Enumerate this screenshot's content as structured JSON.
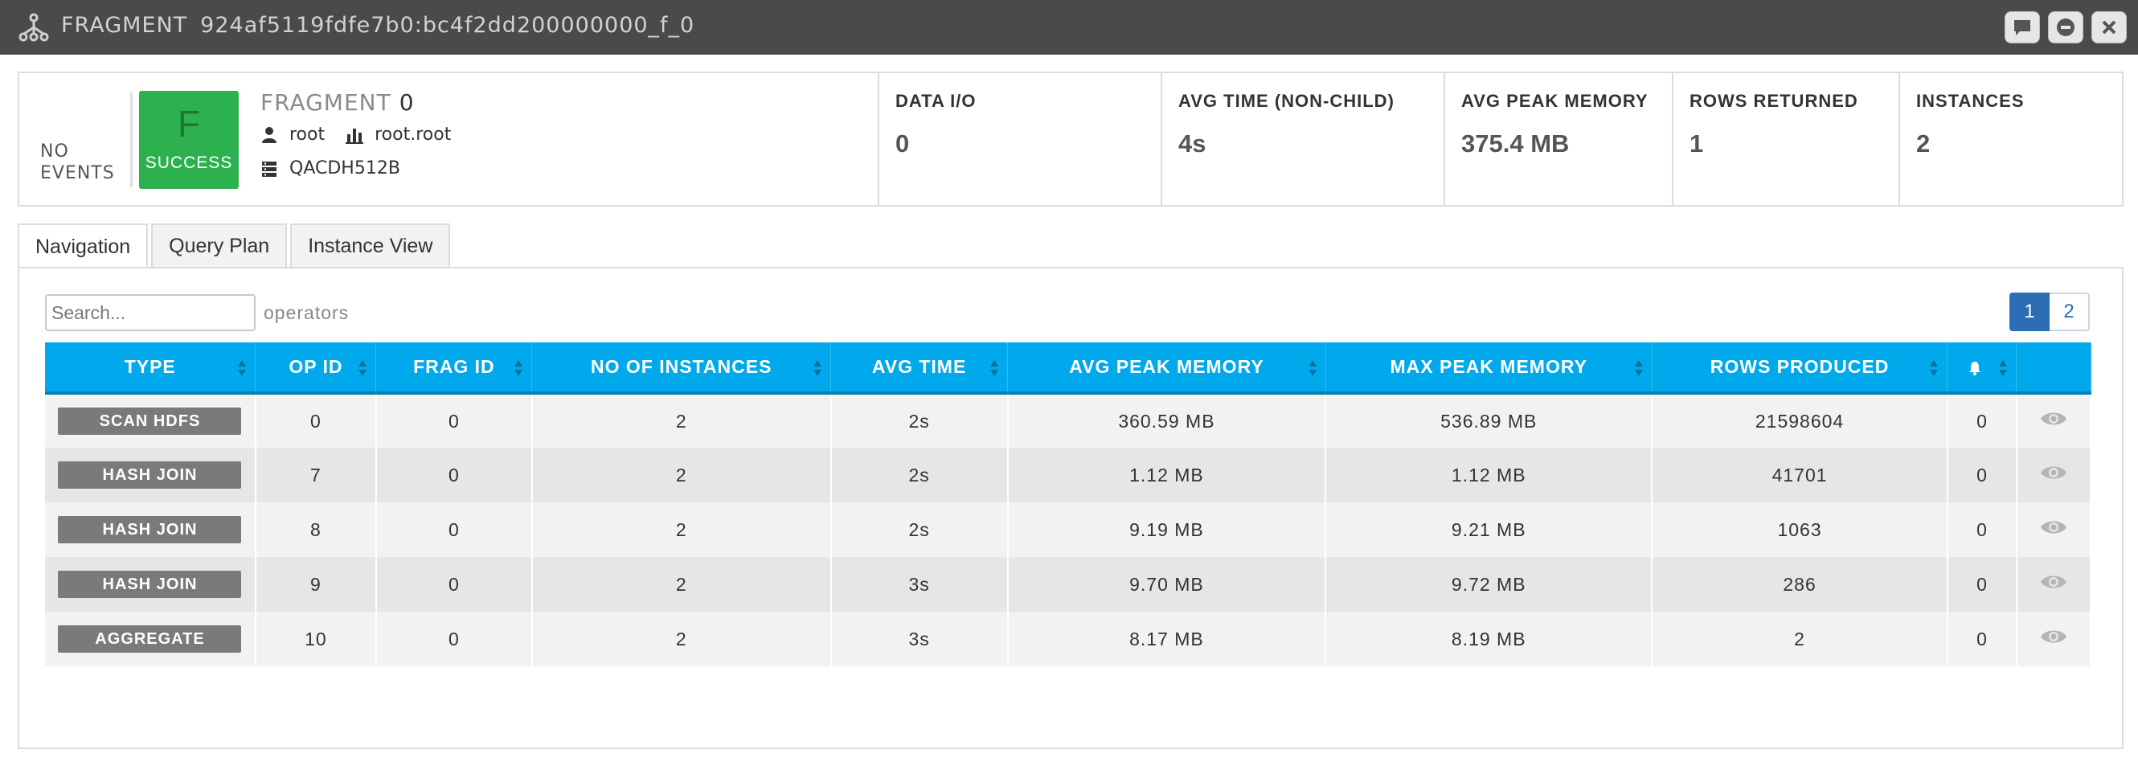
{
  "window": {
    "title_label": "FRAGMENT",
    "title_id": "924af5119fdfe7b0:bc4f2dd200000000_f_0"
  },
  "summary": {
    "events_label": "NO\nEVENTS",
    "status_letter": "F",
    "status_text": "SUCCESS",
    "status_color": "#2db14f",
    "fragment_label": "FRAGMENT",
    "fragment_number": "0",
    "user": "root",
    "pool": "root.root",
    "host": "QACDH512B",
    "stats": [
      {
        "label": "DATA I/O",
        "value": "0"
      },
      {
        "label": "AVG TIME (NON-CHILD)",
        "value": "4s"
      },
      {
        "label": "AVG PEAK MEMORY",
        "value": "375.4 MB"
      },
      {
        "label": "ROWS RETURNED",
        "value": "1"
      },
      {
        "label": "INSTANCES",
        "value": "2"
      }
    ]
  },
  "tabs": [
    {
      "label": "Navigation",
      "active": true
    },
    {
      "label": "Query Plan",
      "active": false
    },
    {
      "label": "Instance View",
      "active": false
    }
  ],
  "search": {
    "placeholder": "Search...",
    "suffix": "operators"
  },
  "pagination": {
    "pages": [
      "1",
      "2"
    ],
    "current": "1"
  },
  "table": {
    "header_color": "#00a9ec",
    "columns": [
      "TYPE",
      "OP ID",
      "FRAG ID",
      "NO OF INSTANCES",
      "AVG TIME",
      "AVG PEAK MEMORY",
      "MAX PEAK MEMORY",
      "ROWS PRODUCED"
    ],
    "alerts_column_icon": "bell-icon",
    "view_column_icon": "eye-icon",
    "rows": [
      {
        "type": "SCAN HDFS",
        "op_id": "0",
        "frag_id": "0",
        "instances": "2",
        "avg_time": "2s",
        "avg_peak_memory": "360.59 MB",
        "max_peak_memory": "536.89 MB",
        "rows_produced": "21598604",
        "alerts": "0"
      },
      {
        "type": "HASH JOIN",
        "op_id": "7",
        "frag_id": "0",
        "instances": "2",
        "avg_time": "2s",
        "avg_peak_memory": "1.12 MB",
        "max_peak_memory": "1.12 MB",
        "rows_produced": "41701",
        "alerts": "0"
      },
      {
        "type": "HASH JOIN",
        "op_id": "8",
        "frag_id": "0",
        "instances": "2",
        "avg_time": "2s",
        "avg_peak_memory": "9.19 MB",
        "max_peak_memory": "9.21 MB",
        "rows_produced": "1063",
        "alerts": "0"
      },
      {
        "type": "HASH JOIN",
        "op_id": "9",
        "frag_id": "0",
        "instances": "2",
        "avg_time": "3s",
        "avg_peak_memory": "9.70 MB",
        "max_peak_memory": "9.72 MB",
        "rows_produced": "286",
        "alerts": "0"
      },
      {
        "type": "AGGREGATE",
        "op_id": "10",
        "frag_id": "0",
        "instances": "2",
        "avg_time": "3s",
        "avg_peak_memory": "8.17 MB",
        "max_peak_memory": "8.19 MB",
        "rows_produced": "2",
        "alerts": "0"
      }
    ]
  }
}
